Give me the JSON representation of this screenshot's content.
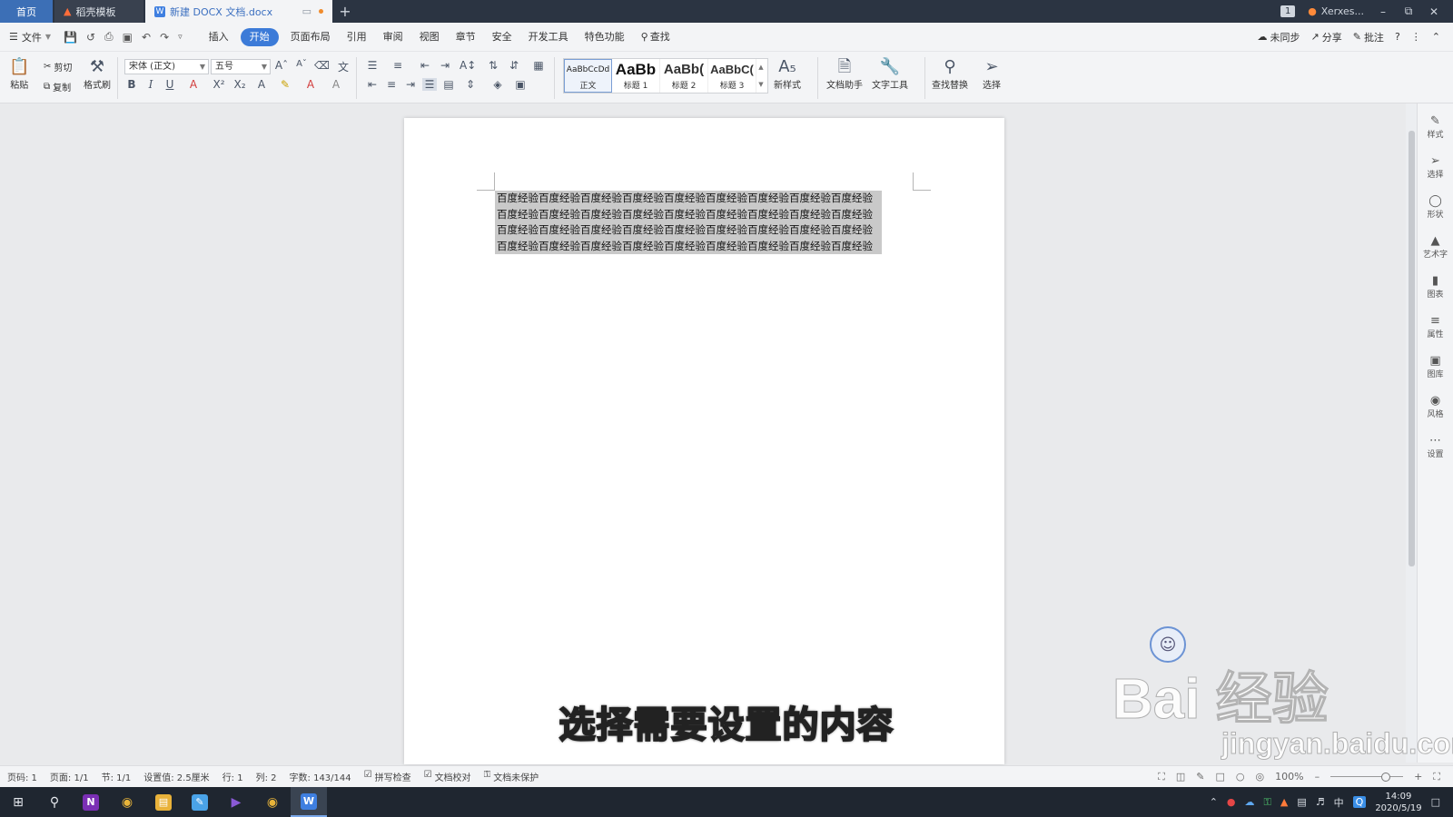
{
  "titlebar": {
    "tabs": [
      {
        "label": "首页"
      },
      {
        "label": "稻壳模板"
      },
      {
        "label": "新建 DOCX 文档.docx"
      }
    ],
    "new_tab": "+",
    "badge": "1",
    "user": "Xerxes..."
  },
  "menubar": {
    "file": "文件",
    "items": [
      "插入",
      "开始",
      "页面布局",
      "引用",
      "审阅",
      "视图",
      "章节",
      "安全",
      "开发工具",
      "特色功能",
      "查找"
    ],
    "right": {
      "sync": "未同步",
      "share": "分享",
      "comment": "批注",
      "help": "?"
    }
  },
  "ribbon": {
    "paste": "粘贴",
    "cut": "剪切",
    "copy": "复制",
    "format_painter": "格式刷",
    "font_name": "宋体 (正文)",
    "font_size": "五号",
    "styles": [
      {
        "preview": "AaBbCcDd",
        "label": "正文"
      },
      {
        "preview": "AaBb",
        "label": "标题 1"
      },
      {
        "preview": "AaBb(",
        "label": "标题 2"
      },
      {
        "preview": "AaBbC(",
        "label": "标题 3"
      }
    ],
    "new_style": "新样式",
    "doc_assistant": "文档助手",
    "text_tools": "文字工具",
    "find_replace": "查找替换",
    "select": "选择"
  },
  "document": {
    "text": "百度经验百度经验百度经验百度经验百度经验百度经验百度经验百度经验百度经验百度经验百度经验百度经验百度经验百度经验百度经验百度经验百度经验百度经验百度经验百度经验百度经验百度经验百度经验百度经验百度经验百度经验百度经验百度经验百度经验百度经验百度经验百度经验百度经验百度经验百度经验百度经验"
  },
  "sidepanel": [
    "样式",
    "选择",
    "形状",
    "艺术字",
    "图表",
    "属性",
    "图库",
    "风格",
    "设置"
  ],
  "statusbar": {
    "page_no": "页码: 1",
    "pages": "页面: 1/1",
    "section": "节: 1/1",
    "position": "设置值: 2.5厘米",
    "row": "行: 1",
    "col": "列: 2",
    "words": "字数: 143/144",
    "spell": "拼写检查",
    "proof": "文档校对",
    "protect": "文档未保护",
    "zoom": "100%"
  },
  "taskbar": {
    "time": "14:09",
    "date": "2020/5/19",
    "ime": "中"
  },
  "overlay": {
    "subtitle": "选择需要设置的内容",
    "watermark_brand": "Bai 经验",
    "watermark_url": "jingyan.baidu.com"
  }
}
